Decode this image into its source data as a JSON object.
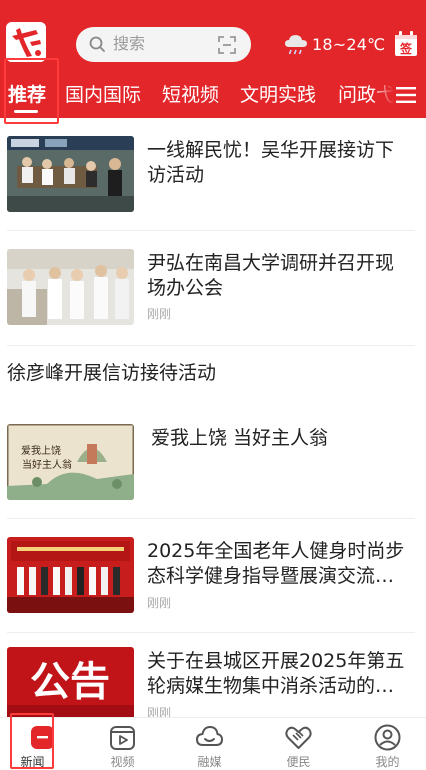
{
  "header": {
    "logo_icon": "yichuan-logo-icon",
    "search_placeholder": "搜索",
    "search_icon": "search-icon",
    "scan_icon": "scan-icon",
    "weather_icon": "rain-cloud-icon",
    "temperature": "18~24℃",
    "sign_icon": "sign-in-calendar-icon",
    "sign_label": "签",
    "brand_color": "#e3262a"
  },
  "tabs": [
    {
      "label": "推荐",
      "active": true
    },
    {
      "label": "国内国际"
    },
    {
      "label": "短视频"
    },
    {
      "label": "文明实践"
    },
    {
      "label": "问政弋"
    }
  ],
  "menu_icon": "hamburger-menu-icon",
  "feed": [
    {
      "title": "一线解民忧！吴华开展接访下访活动",
      "meta": "",
      "thumb": "meeting-photo"
    },
    {
      "title": "尹弘在南昌大学调研并召开现场办公会",
      "meta": "刚刚",
      "thumb": "lab-visit-photo"
    },
    {
      "title": "徐彦峰开展信访接待活动",
      "meta": ""
    },
    {
      "title": "爱我上饶 当好主人翁",
      "meta": "",
      "thumb": "poster-art",
      "thumb_text_1": "爱我上饶",
      "thumb_text_2": "当好主人翁"
    },
    {
      "title": "2025年全国老年人健身时尚步态科学健身指导暨展演交流…",
      "meta": "刚刚",
      "thumb": "stage-event-photo"
    },
    {
      "title": "关于在县城区开展2025年第五轮病媒生物集中消杀活动的…",
      "meta": "刚刚",
      "thumb": "notice-banner",
      "thumb_text": "公告"
    }
  ],
  "bottom_nav": [
    {
      "label": "新闻",
      "icon": "news-icon",
      "active": true
    },
    {
      "label": "视频",
      "icon": "video-icon"
    },
    {
      "label": "融媒",
      "icon": "cloud-icon"
    },
    {
      "label": "便民",
      "icon": "handshake-heart-icon"
    },
    {
      "label": "我的",
      "icon": "user-profile-icon"
    }
  ]
}
